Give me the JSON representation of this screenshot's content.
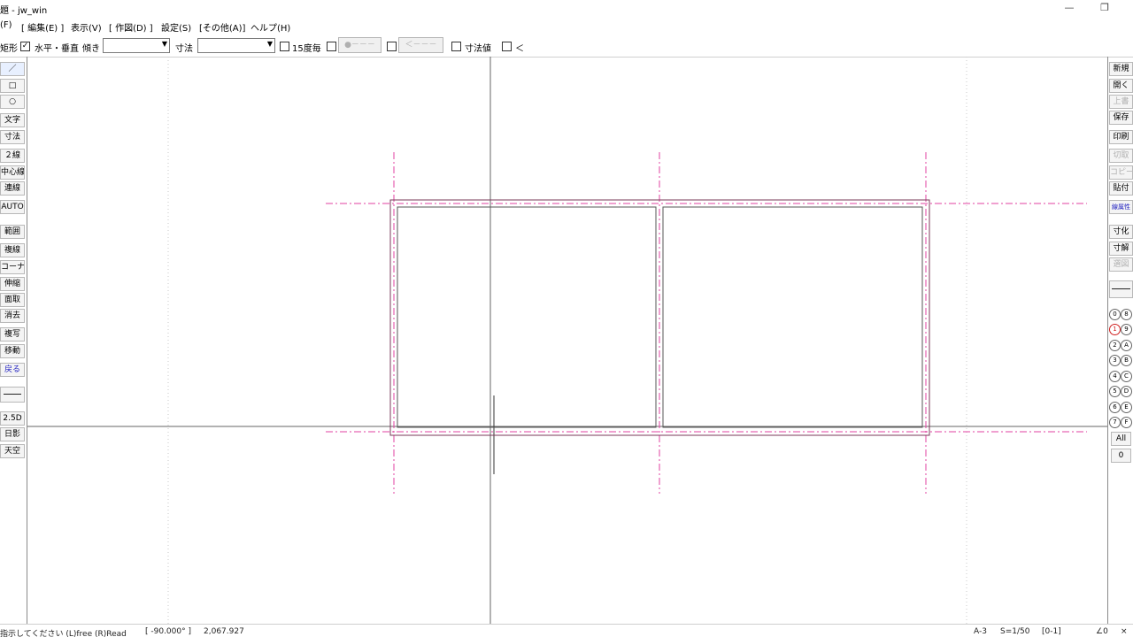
{
  "window": {
    "title": "題 - jw_win",
    "minimize_glyph": "—",
    "restore_glyph": "❐"
  },
  "menu": {
    "items": [
      "(F)",
      "[ 編集(E) ]",
      "表示(V)",
      "[ 作図(D) ]",
      "設定(S)",
      "[その他(A)]",
      "ヘルプ(H)"
    ]
  },
  "controlbar": {
    "rect_label": "矩形",
    "rect_checked": "✓",
    "hv_label": "水平・垂直",
    "slope_label": "傾き",
    "slope_value": "",
    "dim_label": "寸法",
    "dim_value": "",
    "deg15_label": "15度毎",
    "dot_button": "●－－－",
    "arrow_button": "＜－－－",
    "dimval_label": "寸法値",
    "last_label": "＜"
  },
  "lefttools": {
    "items": [
      "／",
      "□",
      "○",
      "文字",
      "寸法",
      "２線",
      "中心線",
      "連線",
      "AUTO",
      "範囲",
      "複線",
      "コーナー",
      "伸縮",
      "面取",
      "消去",
      "複写",
      "移動",
      "戻る",
      "",
      "2.5D",
      "日影",
      "天空"
    ]
  },
  "righttools": {
    "items": [
      "新規",
      "開く",
      "上書",
      "保存",
      "印刷",
      "切取",
      "コピー",
      "貼付",
      "線属性",
      "寸化",
      "寸解",
      "選図"
    ],
    "layers_left": [
      "0",
      "1",
      "2",
      "3",
      "4",
      "5",
      "6",
      "7"
    ],
    "layers_right": [
      "8",
      "9",
      "A",
      "B",
      "C",
      "D",
      "E",
      "F"
    ],
    "all_label": "All",
    "zero_label": "0"
  },
  "colors": {
    "construction_line": "#e040a0",
    "wall_line": "#7a3a5a",
    "inner_line": "#555555",
    "crosshair": "#555555",
    "page_border": "#b8b8b8"
  },
  "status": {
    "message": "指示してください (L)free (R)Read",
    "angle": "[ -90.000° ]",
    "length": "2,067.927",
    "paper": "A-3",
    "scale": "S=1/50",
    "layer_group": "[0-1]",
    "angle_mode": "∠0",
    "close": "×"
  }
}
